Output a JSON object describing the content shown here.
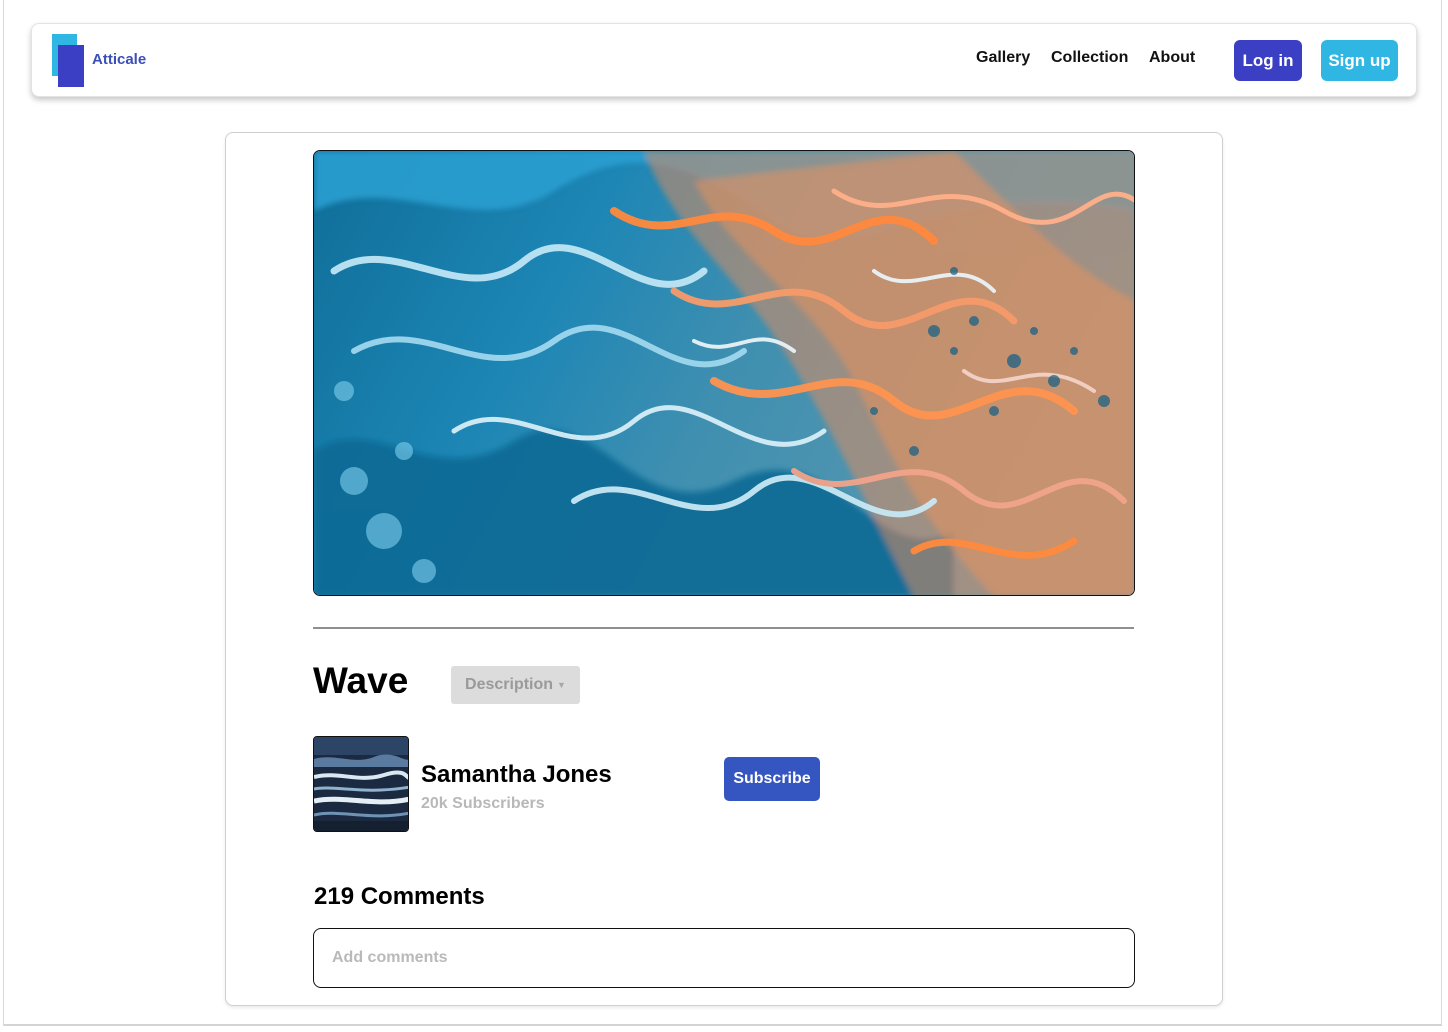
{
  "header": {
    "brand": "Atticale",
    "nav": [
      "Gallery",
      "Collection",
      "About"
    ],
    "login_label": "Log in",
    "signup_label": "Sign up"
  },
  "artwork": {
    "title": "Wave",
    "description_label": "Description"
  },
  "artist": {
    "name": "Samantha Jones",
    "subscribers": "20k Subscribers",
    "subscribe_label": "Subscribe"
  },
  "comments": {
    "count_label": "219 Comments",
    "placeholder": "Add comments"
  },
  "colors": {
    "primary": "#3b3fc4",
    "accent": "#2fb6e2",
    "subscribe": "#3555c0"
  }
}
